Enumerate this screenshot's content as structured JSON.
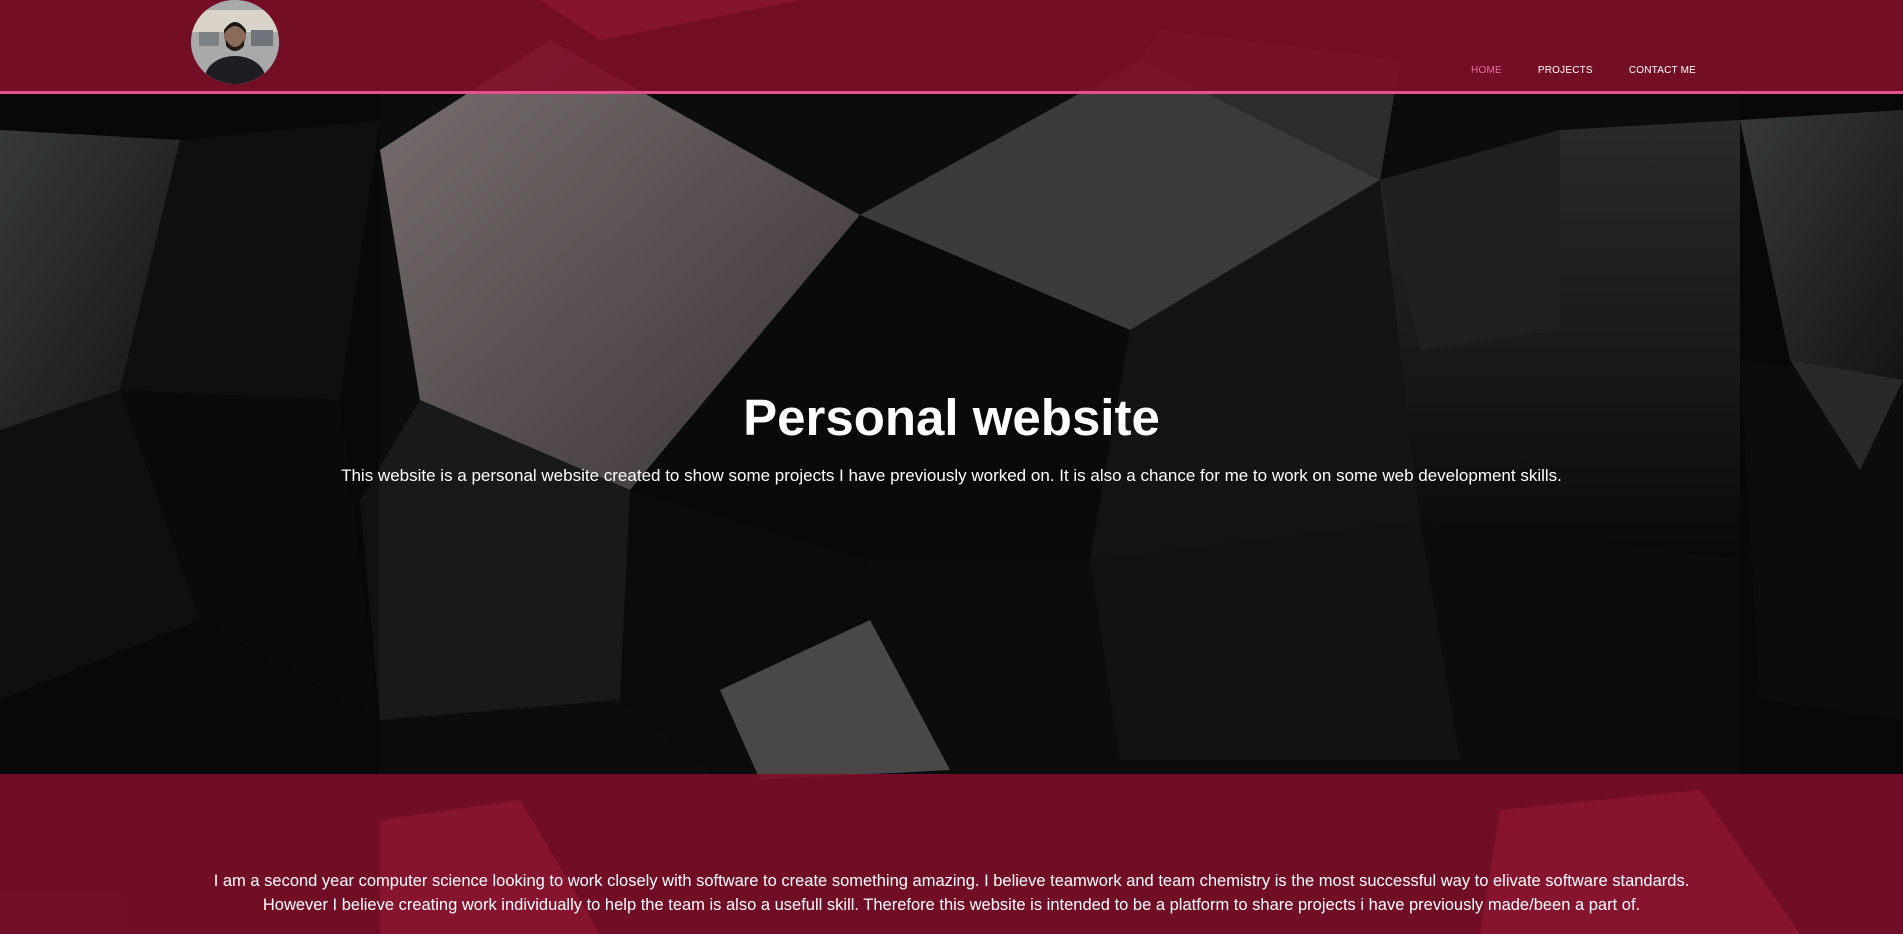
{
  "header": {
    "nav": {
      "home": "HOME",
      "projects": "PROJECTS",
      "contact": "CONTACT ME"
    }
  },
  "hero": {
    "title": "Personal website",
    "subtitle": "This website is a personal website created to show some projects I have previously worked on. It is also a chance for me to work on some web development skills."
  },
  "about": {
    "text": "I am a second year computer science looking to work closely with software to create something amazing. I believe teamwork and team chemistry is the most successful way to elivate software standards. However I believe creating work individually to help the team is also a usefull skill. Therefore this website is intended to be a platform to share projects i have previously made/been a part of."
  },
  "colors": {
    "header_bg": "#800e28",
    "header_border": "#e5508f",
    "nav_active": "#f06aa6",
    "text": "#ffffff"
  },
  "icons": {
    "profile": "profile-photo"
  }
}
